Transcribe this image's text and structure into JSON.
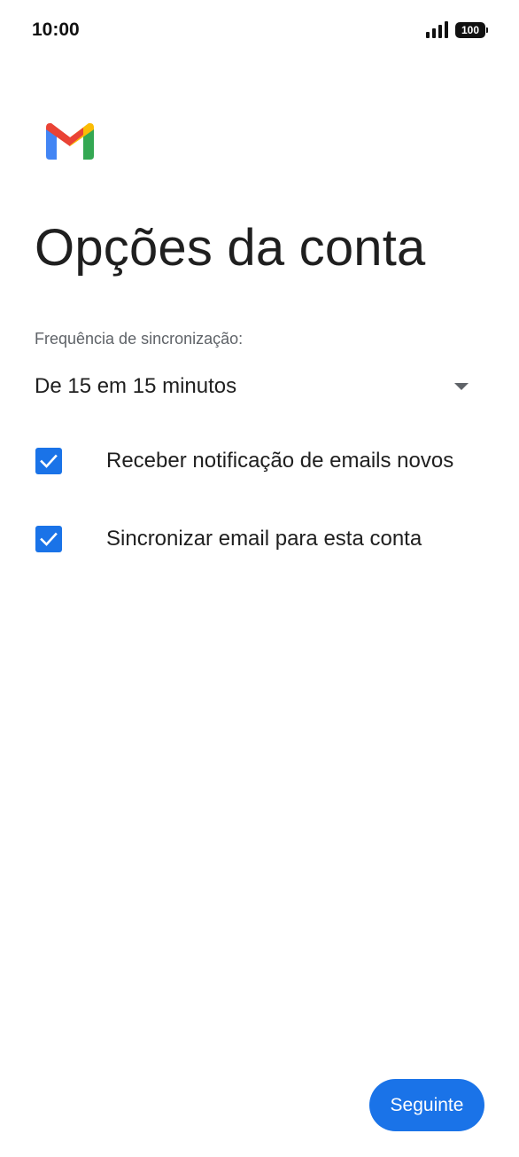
{
  "status_bar": {
    "time": "10:00",
    "battery": "100",
    "icons": [
      "signal-icon",
      "battery-icon"
    ]
  },
  "app": {
    "logo_icon": "gmail-logo-icon",
    "brand_colors": {
      "red": "#EA4335",
      "blue": "#4285F4",
      "green": "#34A853",
      "yellow": "#FBBC04",
      "dark_red": "#C5221F"
    }
  },
  "page": {
    "title": "Opções da conta"
  },
  "sync": {
    "label": "Frequência de sincronização:",
    "selected": "De 15 em 15 minutos",
    "icon": "dropdown-arrow-icon"
  },
  "options": [
    {
      "label": "Receber notificação de emails novos",
      "checked": true
    },
    {
      "label": "Sincronizar email para esta conta",
      "checked": true
    }
  ],
  "footer": {
    "next_label": "Seguinte"
  },
  "colors": {
    "accent": "#1a73e8",
    "text_primary": "#1f1f1f",
    "text_secondary": "#5f6368",
    "background": "#ffffff"
  }
}
